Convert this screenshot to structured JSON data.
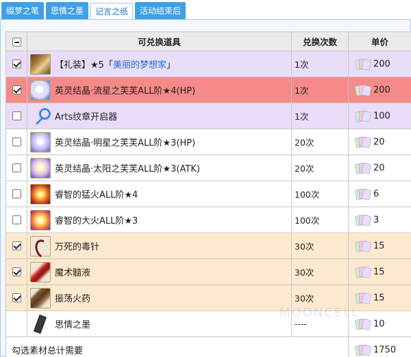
{
  "tabs": [
    {
      "label": "缀梦之笔",
      "active": false
    },
    {
      "label": "思情之墨",
      "active": false
    },
    {
      "label": "记言之纸",
      "active": true
    },
    {
      "label": "活动结束后",
      "active": false
    }
  ],
  "table": {
    "headers": {
      "name": "可兑换道具",
      "count": "兑换次数",
      "price": "单价"
    },
    "rows": [
      {
        "checked": true,
        "name_prefix": "【礼装】★5「",
        "name_link": "美丽的梦想家",
        "name_suffix": "」",
        "count": "1次",
        "price": "200",
        "highlight": "lavender",
        "icon": "craft-essence-icon"
      },
      {
        "checked": true,
        "name": "英灵结晶·流星之芙芙ALL阶★4(HP)",
        "count": "1次",
        "price": "200",
        "highlight": "red",
        "icon": "fou-crystal-icon"
      },
      {
        "checked": false,
        "name": "Arts纹章开启器",
        "count": "1次",
        "price": "100",
        "highlight": "lavender",
        "icon": "key-icon"
      },
      {
        "checked": false,
        "name": "英灵结晶·明星之芙芙ALL阶★3(HP)",
        "count": "20次",
        "price": "20",
        "highlight": "white",
        "icon": "fou-crystal-icon"
      },
      {
        "checked": false,
        "name": "英灵结晶·太阳之芙芙ALL阶★3(ATK)",
        "count": "20次",
        "price": "20",
        "highlight": "white",
        "icon": "fou-crystal-icon"
      },
      {
        "checked": false,
        "name": "睿智的猛火ALL阶★4",
        "count": "100次",
        "price": "6",
        "highlight": "white",
        "icon": "ember-icon"
      },
      {
        "checked": false,
        "name": "睿智的大火ALL阶★3",
        "count": "100次",
        "price": "3",
        "highlight": "white",
        "icon": "ember-icon"
      },
      {
        "checked": true,
        "name": "万死的毒针",
        "count": "30次",
        "price": "15",
        "highlight": "peach",
        "icon": "poison-needle-icon"
      },
      {
        "checked": true,
        "name": "魔术髓液",
        "count": "30次",
        "price": "15",
        "highlight": "peach",
        "icon": "magic-marrow-icon"
      },
      {
        "checked": true,
        "name": "振荡火药",
        "count": "30次",
        "price": "15",
        "highlight": "peach",
        "icon": "gunpowder-icon"
      },
      {
        "checked": null,
        "name": "思情之墨",
        "count": "----",
        "price": "10",
        "highlight": "white",
        "icon": "ink-icon"
      }
    ],
    "total_label": "勾选素材总计需要",
    "total_value": "1750"
  },
  "currency_icon": "paper-ticket-icon",
  "watermark": "MOONCELL",
  "colors": {
    "tab_blue": "#3ea0e6",
    "row_lavender": "#e9dcf8",
    "row_red": "#f58a88",
    "row_peach": "#fde9cf",
    "link_blue": "#1a6fd0"
  }
}
